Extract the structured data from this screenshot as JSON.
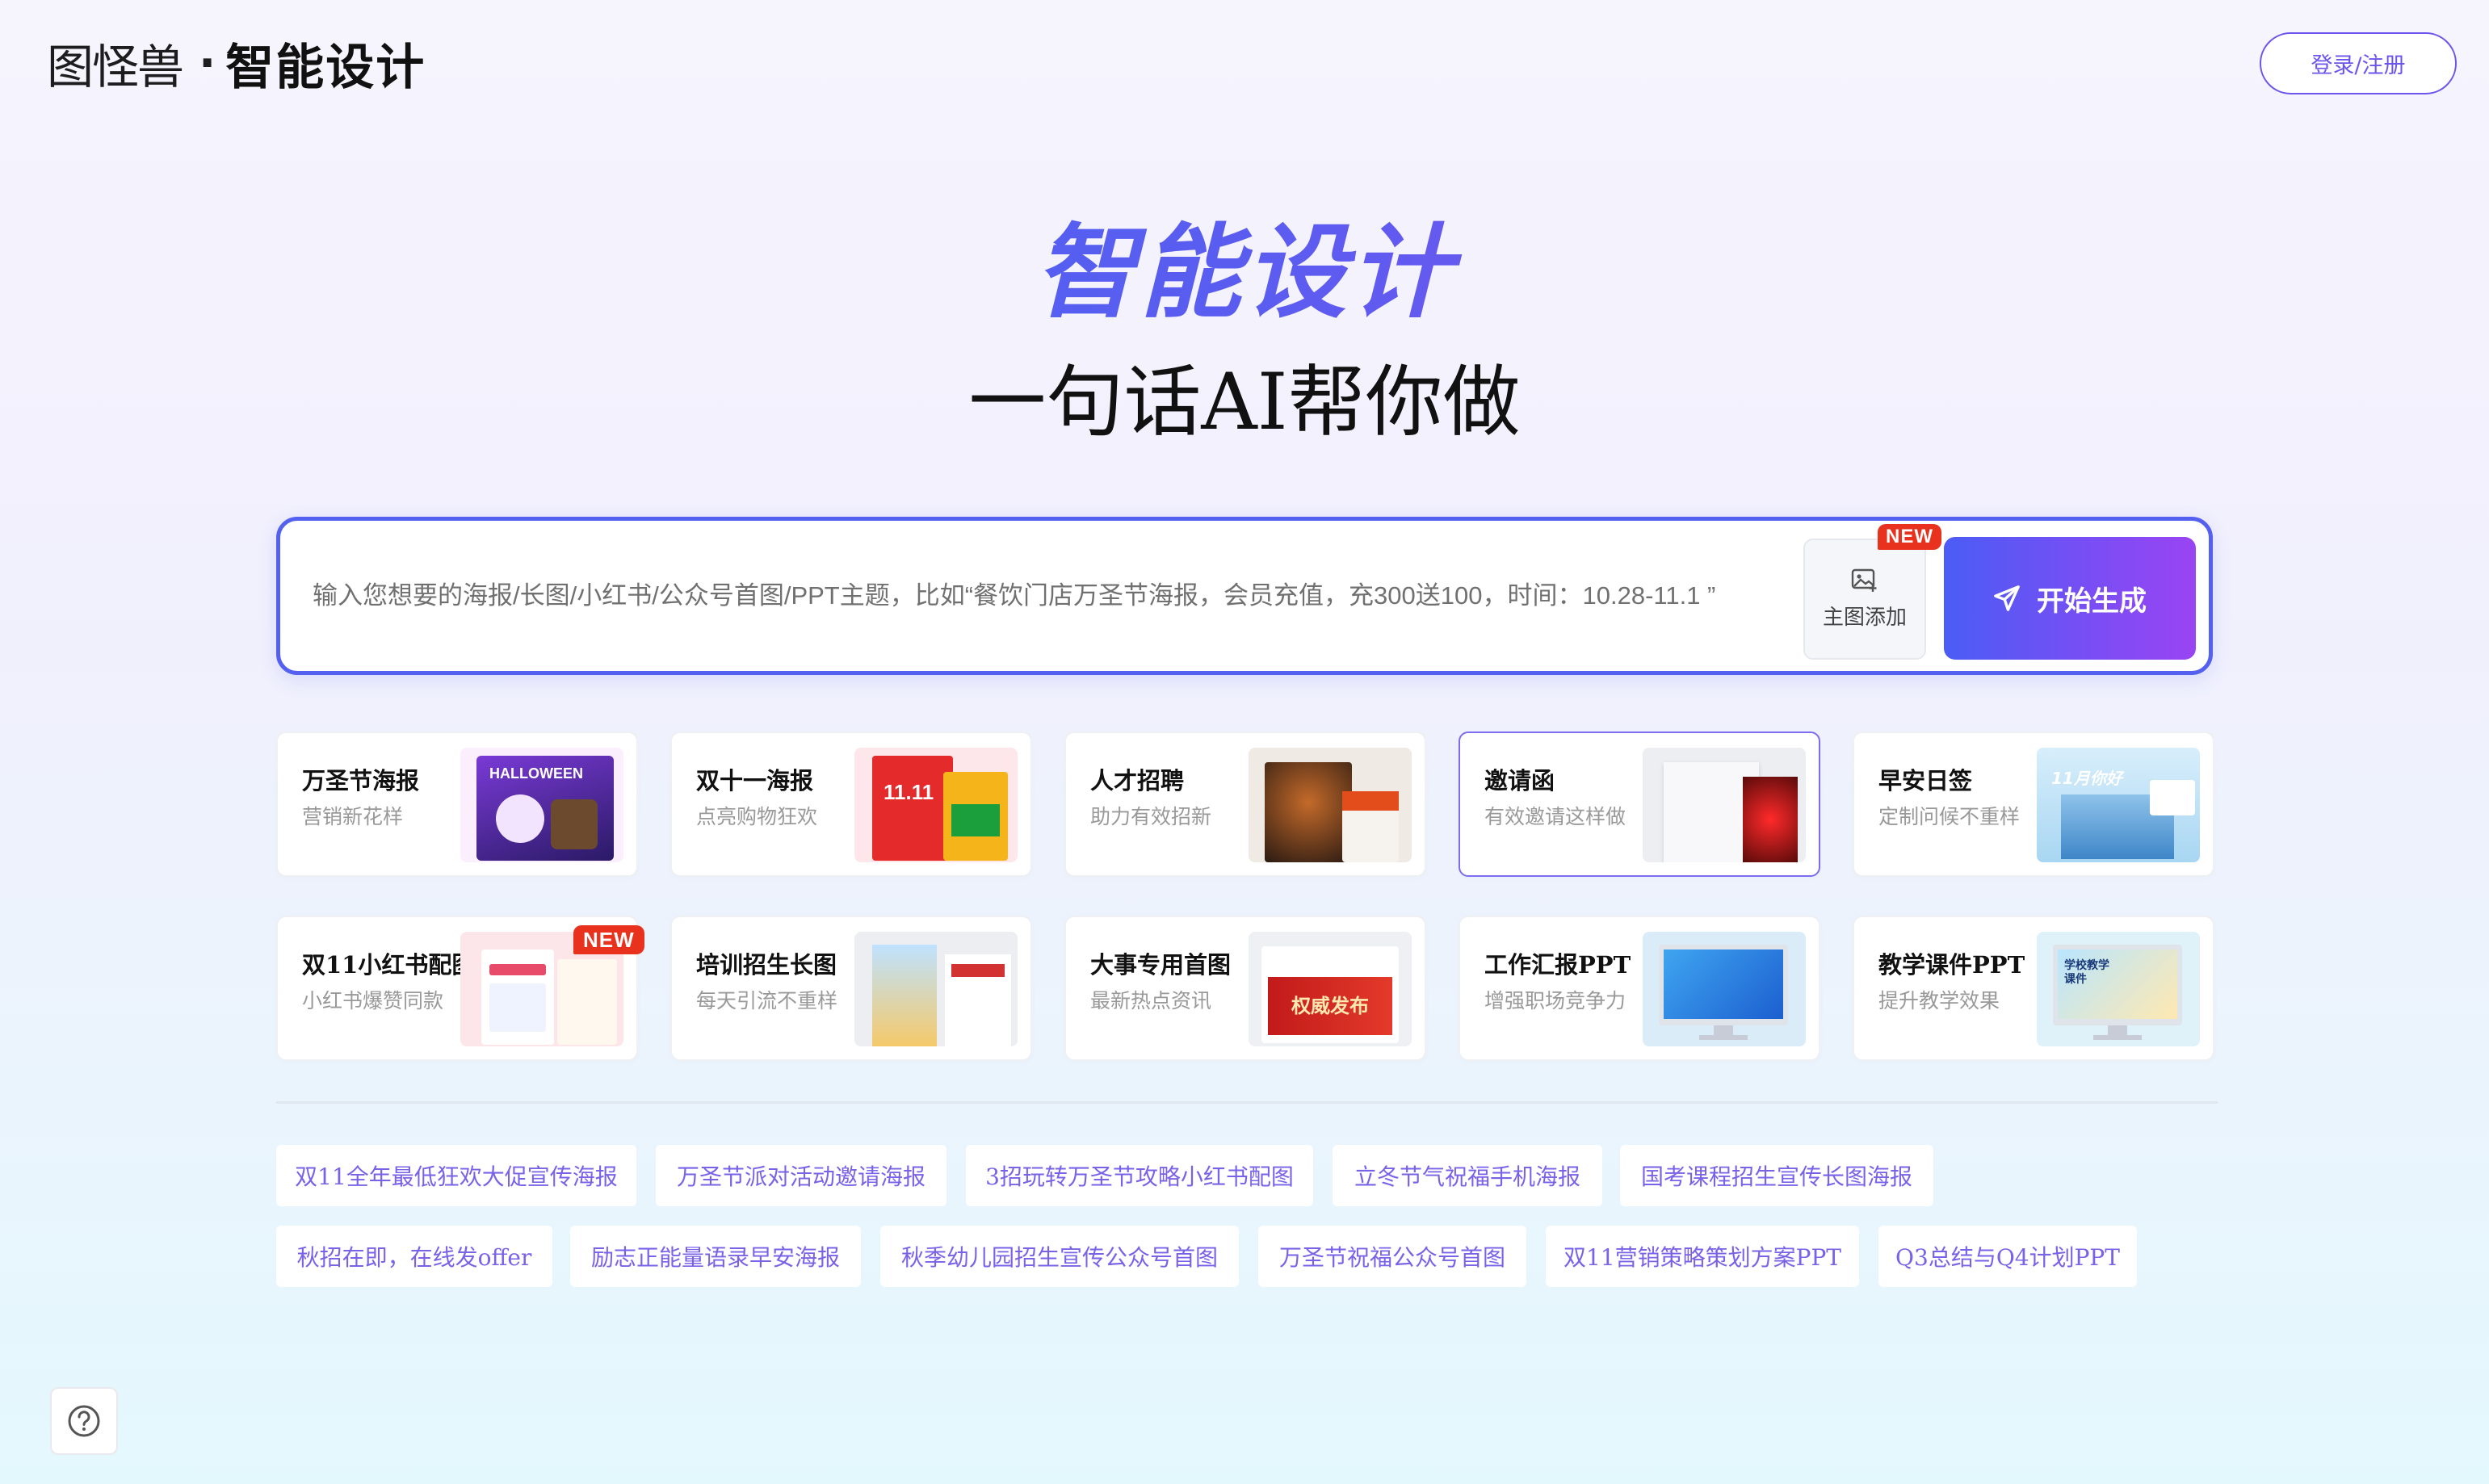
{
  "header": {
    "logo_text": "图怪兽",
    "logo_dot": "·",
    "product_name": "智能设计",
    "login_label": "登录/注册"
  },
  "hero": {
    "title": "智能设计",
    "subtitle": "一句话AI帮你做"
  },
  "search": {
    "placeholder": "输入您想要的海报/长图/小红书/公众号首图/PPT主题，比如“餐饮门店万圣节海报，会员充值，充300送100，时间：10.28-11.1 ”",
    "image_add_label": "主图添加",
    "image_add_badge": "NEW",
    "generate_label": "开始生成"
  },
  "categories": [
    {
      "title": "万圣节海报",
      "desc": "营销新花样",
      "thumb_text": "HALLOWEEN"
    },
    {
      "title": "双十一海报",
      "desc": "点亮购物狂欢",
      "thumb_text": "11.11"
    },
    {
      "title": "人才招聘",
      "desc": "助力有效招新",
      "thumb_text": ""
    },
    {
      "title": "邀请函",
      "desc": "有效邀请这样做",
      "thumb_text": ""
    },
    {
      "title": "早安日签",
      "desc": "定制问候不重样",
      "thumb_text": "11月你好"
    },
    {
      "title": "双11小红书配图",
      "desc": "小红书爆赞同款",
      "thumb_text": "",
      "badge": "NEW"
    },
    {
      "title": "培训招生长图",
      "desc": "每天引流不重样",
      "thumb_text": ""
    },
    {
      "title": "大事专用首图",
      "desc": "最新热点资讯",
      "thumb_text": "权威发布"
    },
    {
      "title": "工作汇报PPT",
      "desc": "增强职场竞争力",
      "thumb_text": ""
    },
    {
      "title": "教学课件PPT",
      "desc": "提升教学效果",
      "thumb_text": "学校教学课件"
    }
  ],
  "tags_row1": [
    "双11全年最低狂欢大促宣传海报",
    "万圣节派对活动邀请海报",
    "3招玩转万圣节攻略小红书配图",
    "立冬节气祝福手机海报",
    "国考课程招生宣传长图海报"
  ],
  "tags_row2": [
    "秋招在即，在线发offer",
    "励志正能量语录早安海报",
    "秋季幼儿园招生宣传公众号首图",
    "万圣节祝福公众号首图",
    "双11营销策略策划方案PPT",
    "Q3总结与Q4计划PPT"
  ],
  "colors": {
    "accent": "#6b55ec",
    "search_border": "#5360f0",
    "badge_red": "#e8321e",
    "tag_text": "#7a62e8"
  },
  "help_icon": "question-circle-icon"
}
